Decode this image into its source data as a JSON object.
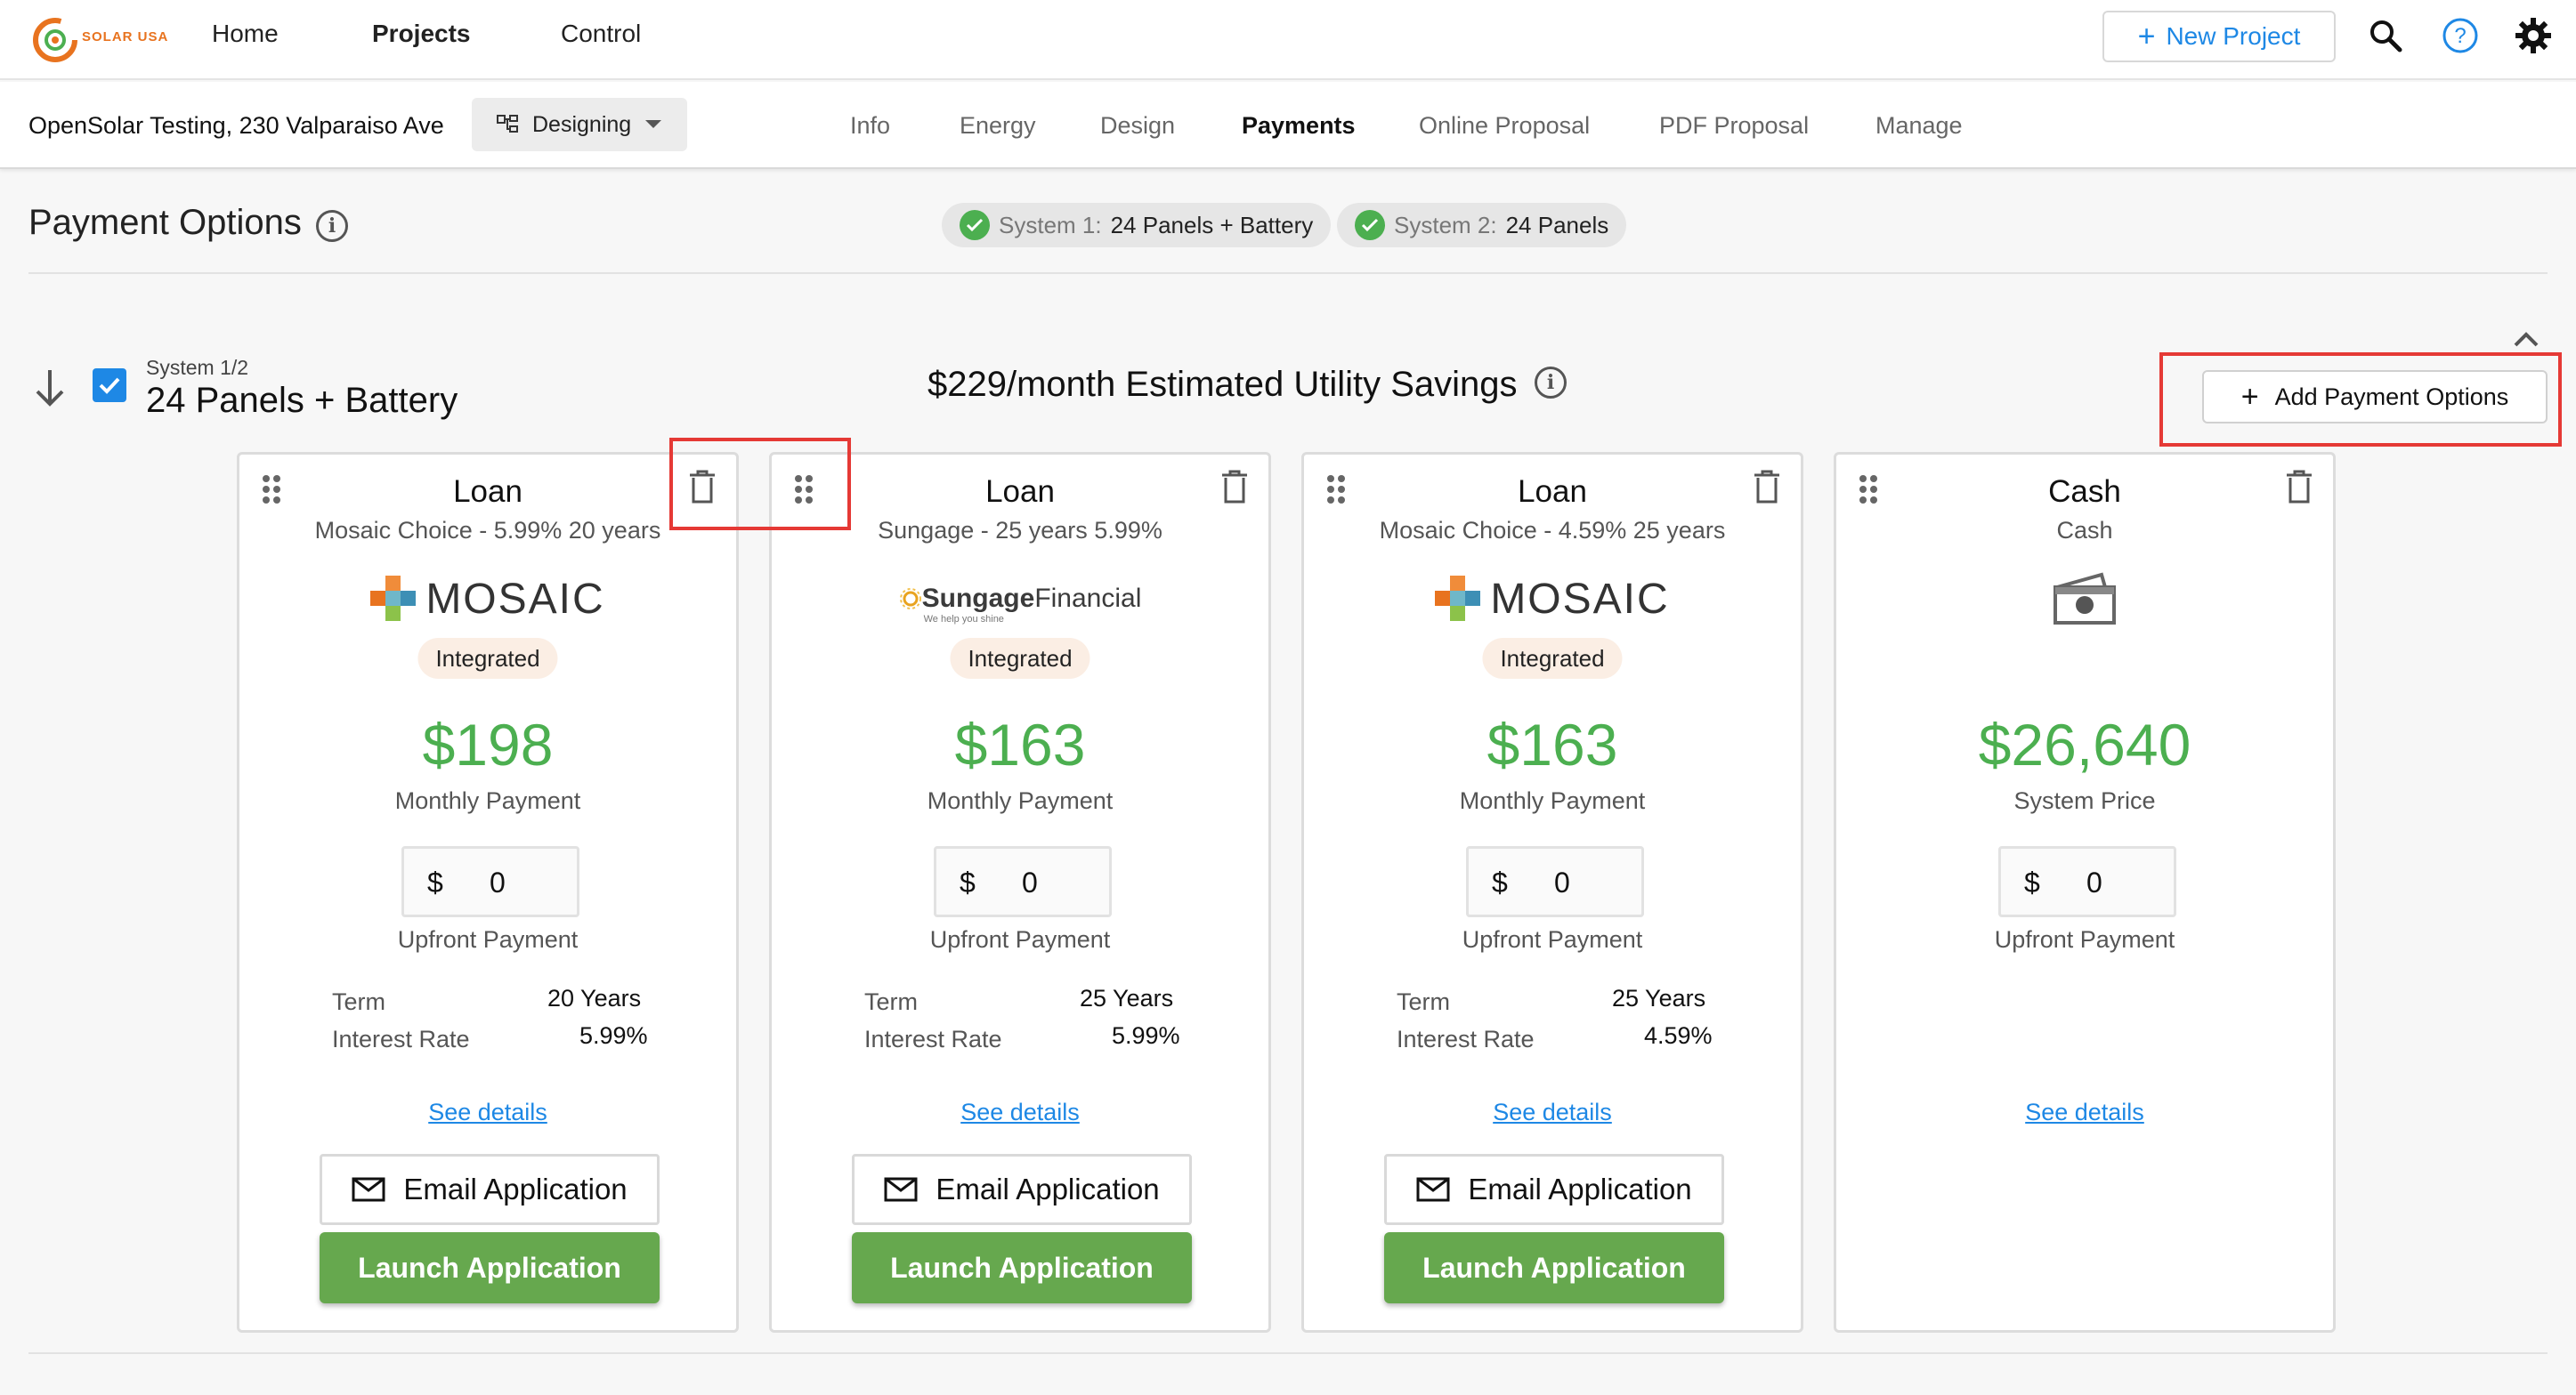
{
  "brand": {
    "logo_text": "SOLAR USA",
    "accent": "#e8731f",
    "link_color": "#1e88e5",
    "price_color": "#4caf50"
  },
  "nav": {
    "home": "Home",
    "projects": "Projects",
    "control": "Control",
    "new_project": "New Project"
  },
  "project": {
    "address": "OpenSolar Testing, 230 Valparaiso Ave",
    "status": "Designing"
  },
  "tabs": [
    "Info",
    "Energy",
    "Design",
    "Payments",
    "Online Proposal",
    "PDF Proposal",
    "Manage"
  ],
  "active_tab": "Payments",
  "page": {
    "title": "Payment Options"
  },
  "systems_chips": [
    {
      "label": "System 1:",
      "value": "24 Panels + Battery"
    },
    {
      "label": "System 2:",
      "value": "24 Panels"
    }
  ],
  "system": {
    "sub": "System 1/2",
    "name": "24 Panels + Battery",
    "savings": "$229/month Estimated Utility Savings",
    "add_button": "Add Payment Options",
    "selected": true
  },
  "cards": [
    {
      "title": "Loan",
      "subtitle": "Mosaic Choice - 5.99% 20 years",
      "logo": "MOSAIC",
      "badge": "Integrated",
      "amount": "$198",
      "amount_label": "Monthly Payment",
      "currency": "$",
      "upfront": "0",
      "upfront_label": "Upfront Payment",
      "term_label": "Term",
      "term_value": "20 Years",
      "rate_label": "Interest Rate",
      "rate_value": "5.99%",
      "details": "See details",
      "email": "Email Application",
      "launch": "Launch Application"
    },
    {
      "title": "Loan",
      "subtitle": "Sungage - 25 years 5.99%",
      "logo": "Sungage",
      "logo_suffix": "Financial",
      "logo_tagline": "We help you shine",
      "badge": "Integrated",
      "amount": "$163",
      "amount_label": "Monthly Payment",
      "currency": "$",
      "upfront": "0",
      "upfront_label": "Upfront Payment",
      "term_label": "Term",
      "term_value": "25 Years",
      "rate_label": "Interest Rate",
      "rate_value": "5.99%",
      "details": "See details",
      "email": "Email Application",
      "launch": "Launch Application"
    },
    {
      "title": "Loan",
      "subtitle": "Mosaic Choice - 4.59% 25 years",
      "logo": "MOSAIC",
      "badge": "Integrated",
      "amount": "$163",
      "amount_label": "Monthly Payment",
      "currency": "$",
      "upfront": "0",
      "upfront_label": "Upfront Payment",
      "term_label": "Term",
      "term_value": "25 Years",
      "rate_label": "Interest Rate",
      "rate_value": "4.59%",
      "details": "See details",
      "email": "Email Application",
      "launch": "Launch Application"
    },
    {
      "title": "Cash",
      "subtitle": "Cash",
      "logo_icon": "cash-icon",
      "amount": "$26,640",
      "amount_label": "System Price",
      "currency": "$",
      "upfront": "0",
      "upfront_label": "Upfront Payment",
      "details": "See details"
    }
  ]
}
